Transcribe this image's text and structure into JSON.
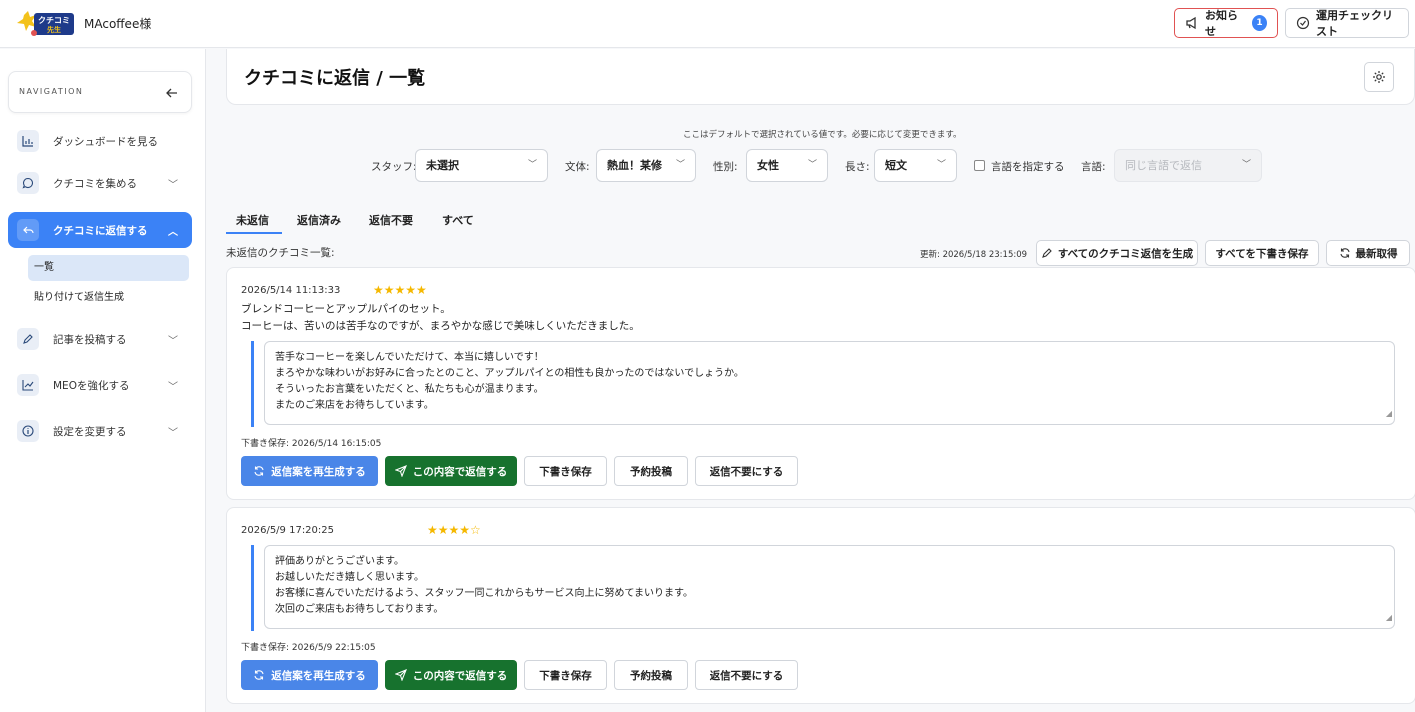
{
  "header": {
    "company": "MAcoffee様",
    "notice_label": "お知らせ",
    "notice_count": "1",
    "checklist_label": "運用チェックリスト"
  },
  "sidebar": {
    "title": "NAVIGATION",
    "items": [
      {
        "label": "ダッシュボードを見る",
        "icon": "bar-chart-icon"
      },
      {
        "label": "クチコミを集める",
        "icon": "chat-bubble-icon"
      },
      {
        "label": "クチコミに返信する",
        "icon": "reply-icon",
        "active": true
      },
      {
        "label": "記事を投稿する",
        "icon": "pencil-icon"
      },
      {
        "label": "MEOを強化する",
        "icon": "line-chart-icon"
      },
      {
        "label": "設定を変更する",
        "icon": "info-icon"
      }
    ],
    "subitems": [
      {
        "label": "一覧",
        "active": true
      },
      {
        "label": "貼り付けて返信生成"
      }
    ]
  },
  "page": {
    "title": "クチコミに返信 / 一覧"
  },
  "filters": {
    "note": "ここはデフォルトで選択されている値です。必要に応じて変更できます。",
    "staff_label": "スタッフ:",
    "staff_value": "未選択",
    "style_label": "文体:",
    "style_value": "熱血！某修",
    "gender_label": "性別:",
    "gender_value": "女性",
    "length_label": "長さ:",
    "length_value": "短文",
    "lang_checkbox_label": "言語を指定する",
    "lang_label": "言語:",
    "lang_value": "同じ言語で返信"
  },
  "tabs": [
    "未返信",
    "返信済み",
    "返信不要",
    "すべて"
  ],
  "list": {
    "label": "未返信のクチコミ一覧:",
    "updated": "更新: 2026/5/18 23:15:09",
    "generate_all": "すべてのクチコミ返信を生成",
    "save_all": "すべてを下書き保存",
    "refresh": "最新取得"
  },
  "reviews": [
    {
      "date": "2026/5/14 11:13:33",
      "stars": "★★★★★",
      "rating": 5,
      "text_lines": [
        "ブレンドコーヒーとアップルパイのセット。",
        "コーヒーは、苦いのは苦手なのですが、まろやかな感じで美味しくいただきました。"
      ],
      "reply_lines": [
        "苦手なコーヒーを楽しんでいただけて、本当に嬉しいです！",
        "まろやかな味わいがお好みに合ったとのこと、アップルパイとの相性も良かったのではないでしょうか。",
        "そういったお言葉をいただくと、私たちも心が温まります。",
        "またのご来店をお待ちしています。"
      ],
      "draft": "下書き保存: 2026/5/14 16:15:05"
    },
    {
      "date": "2026/5/9 17:20:25",
      "stars": "★★★★☆",
      "rating": 4,
      "text_lines": [],
      "reply_lines": [
        "評価ありがとうございます。",
        "お越しいただき嬉しく思います。",
        "お客様に喜んでいただけるよう、スタッフ一同これからもサービス向上に努めてまいります。",
        "次回のご来店もお待ちしております。"
      ],
      "draft": "下書き保存: 2026/5/9 22:15:05"
    }
  ],
  "actions": {
    "regenerate": "返信案を再生成する",
    "reply": "この内容で返信する",
    "save_draft": "下書き保存",
    "schedule": "予約投稿",
    "no_reply": "返信不要にする"
  },
  "colors": {
    "accent": "#3b82f6",
    "reply_green": "#17722e",
    "star": "#f5b800",
    "notice_border": "#e05252"
  }
}
